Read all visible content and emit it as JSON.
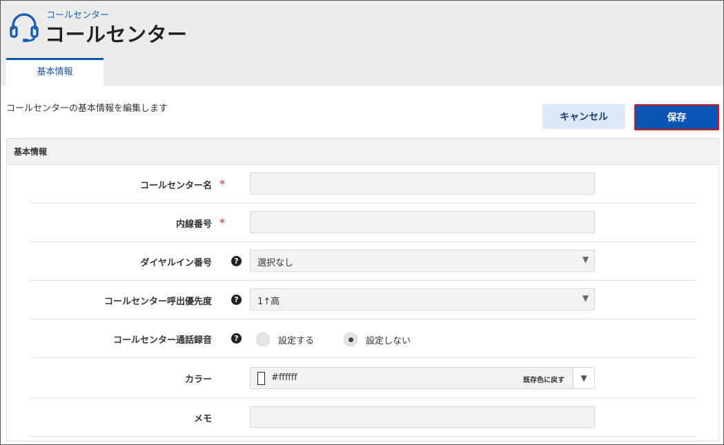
{
  "header": {
    "breadcrumb": "コールセンター",
    "title": "コールセンター",
    "icon": "headset-icon"
  },
  "tabs": [
    {
      "label": "基本情報",
      "active": true
    }
  ],
  "description": "コールセンターの基本情報を編集します",
  "actions": {
    "cancel_label": "キャンセル",
    "save_label": "保存"
  },
  "panel": {
    "title": "基本情報"
  },
  "form": {
    "callcenter_name": {
      "label": "コールセンター名",
      "required_mark": "*",
      "value": ""
    },
    "extension": {
      "label": "内線番号",
      "required_mark": "*",
      "value": ""
    },
    "dial_in": {
      "label": "ダイヤルイン番号",
      "help": "?",
      "selected": "選択なし"
    },
    "priority": {
      "label": "コールセンター呼出優先度",
      "help": "?",
      "selected": "1↑高"
    },
    "recording": {
      "label": "コールセンター通話録音",
      "help": "?",
      "options": [
        "設定する",
        "設定しない"
      ],
      "selected": "設定しない"
    },
    "color": {
      "label": "カラー",
      "value": "#ffffff",
      "reset_label": "既存色に戻す"
    },
    "memo": {
      "label": "メモ",
      "value": ""
    }
  },
  "colors": {
    "accent": "#0a54b3",
    "required": "#d81e1e",
    "header_bg": "#ececec"
  }
}
